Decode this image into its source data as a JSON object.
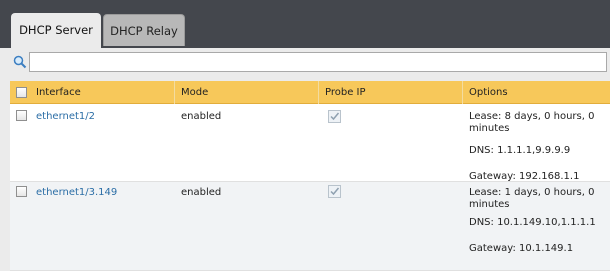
{
  "tabs": [
    {
      "label": "DHCP Server",
      "active": true
    },
    {
      "label": "DHCP Relay",
      "active": false
    }
  ],
  "search": {
    "placeholder": "",
    "value": ""
  },
  "table": {
    "columns": [
      "Interface",
      "Mode",
      "Probe IP",
      "Options"
    ],
    "rows": [
      {
        "interface": "ethernet1/2",
        "mode": "enabled",
        "probe_ip_checked": true,
        "lease": "Lease: 8 days, 0 hours, 0 minutes",
        "dns": "DNS: 1.1.1.1,9.9.9.9",
        "gateway": "Gateway: 192.168.1.1"
      },
      {
        "interface": "ethernet1/3.149",
        "mode": "enabled",
        "probe_ip_checked": true,
        "lease": "Lease: 1 days, 0 hours, 0 minutes",
        "dns": "DNS: 10.1.149.10,1.1.1.1",
        "gateway": "Gateway: 10.1.149.1"
      }
    ]
  },
  "colors": {
    "header_bg": "#f7c85a",
    "link": "#2c6ea6",
    "top_bar": "#44474d"
  }
}
